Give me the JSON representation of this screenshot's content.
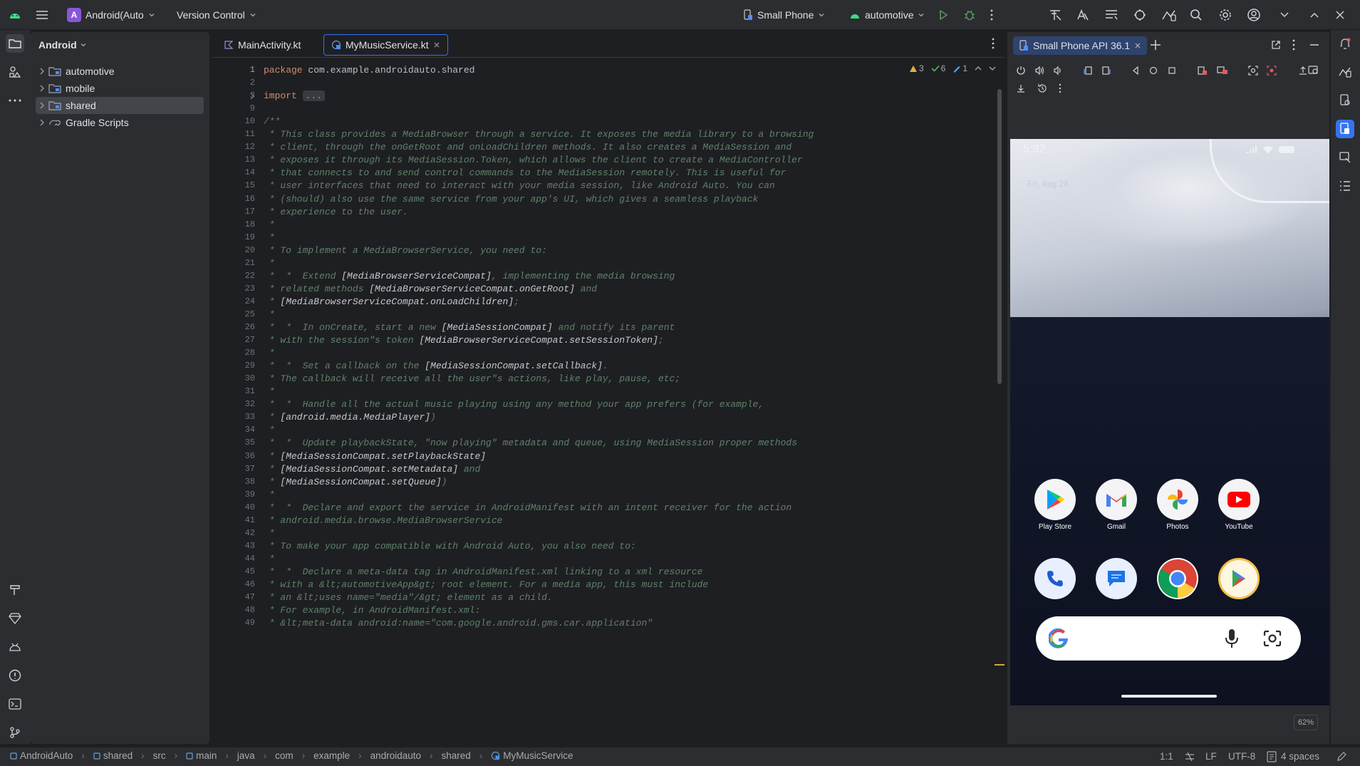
{
  "titlebar": {
    "project_badge": "A",
    "project_name": "Android(Auto",
    "vcs": "Version Control",
    "device": "Small Phone",
    "run_config": "automotive"
  },
  "project_panel": {
    "title": "Android",
    "items": [
      {
        "label": "automotive",
        "selected": false
      },
      {
        "label": "mobile",
        "selected": false
      },
      {
        "label": "shared",
        "selected": true
      },
      {
        "label": "Gradle Scripts",
        "selected": false
      }
    ]
  },
  "editor": {
    "tabs": [
      {
        "label": "MainActivity.kt",
        "active": false
      },
      {
        "label": "MyMusicService.kt",
        "active": true
      }
    ],
    "inspections": {
      "warnings": "3",
      "ok": "6",
      "typos": "1"
    },
    "line_numbers": [
      "1",
      "2",
      "3",
      "9",
      "10",
      "11",
      "12",
      "13",
      "14",
      "15",
      "16",
      "17",
      "18",
      "19",
      "20",
      "21",
      "22",
      "23",
      "24",
      "25",
      "26",
      "27",
      "28",
      "29",
      "30",
      "31",
      "32",
      "33",
      "34",
      "35",
      "36",
      "37",
      "38",
      "39",
      "40",
      "41",
      "42",
      "43",
      "44",
      "45",
      "46",
      "47",
      "48",
      "49"
    ],
    "lines": [
      {
        "a": "package",
        "b": " com.example.androidauto.shared"
      },
      {
        "a": "",
        "b": ""
      },
      {
        "a": "import",
        "b": "..."
      },
      {
        "t": ""
      },
      {
        "t": "/**"
      },
      {
        "t": " * This class provides a MediaBrowser through a service. It exposes the media library to a browsing"
      },
      {
        "t": " * client, through the onGetRoot and onLoadChildren methods. It also creates a MediaSession and"
      },
      {
        "t": " * exposes it through its MediaSession.Token, which allows the client to create a MediaController"
      },
      {
        "t": " * that connects to and send control commands to the MediaSession remotely. This is useful for"
      },
      {
        "t": " * user interfaces that need to interact with your media session, like Android Auto. You can"
      },
      {
        "t": " * (should) also use the same service from your app's UI, which gives a seamless playback"
      },
      {
        "t": " * experience to the user."
      },
      {
        "t": " *"
      },
      {
        "t": " *"
      },
      {
        "t": " * To implement a MediaBrowserService, you need to:"
      },
      {
        "t": " *"
      },
      {
        "p": " *  *  Extend ",
        "r": "[MediaBrowserServiceCompat]",
        "s": ", implementing the media browsing"
      },
      {
        "p": " * related methods ",
        "r": "[MediaBrowserServiceCompat.onGetRoot]",
        "s": " and"
      },
      {
        "p": " * ",
        "r": "[MediaBrowserServiceCompat.onLoadChildren]",
        "s": ";"
      },
      {
        "t": " *"
      },
      {
        "p": " *  *  In onCreate, start a new ",
        "r": "[MediaSessionCompat]",
        "s": " and notify its parent"
      },
      {
        "p": " * with the session\"s token ",
        "r": "[MediaBrowserServiceCompat.setSessionToken]",
        "s": ";"
      },
      {
        "t": " *"
      },
      {
        "p": " *  *  Set a callback on the ",
        "r": "[MediaSessionCompat.setCallback]",
        "s": "."
      },
      {
        "t": " * The callback will receive all the user\"s actions, like play, pause, etc;"
      },
      {
        "t": " *"
      },
      {
        "t": " *  *  Handle all the actual music playing using any method your app prefers (for example,"
      },
      {
        "p": " * ",
        "r": "[android.media.MediaPlayer]",
        "s": ")"
      },
      {
        "t": " *"
      },
      {
        "t": " *  *  Update playbackState, \"now playing\" metadata and queue, using MediaSession proper methods"
      },
      {
        "p": " * ",
        "r": "[MediaSessionCompat.setPlaybackState]",
        "s": ""
      },
      {
        "p": " * ",
        "r": "[MediaSessionCompat.setMetadata]",
        "s": " and"
      },
      {
        "p": " * ",
        "r": "[MediaSessionCompat.setQueue]",
        "s": ")"
      },
      {
        "t": " *"
      },
      {
        "t": " *  *  Declare and export the service in AndroidManifest with an intent receiver for the action"
      },
      {
        "t": " * android.media.browse.MediaBrowserService"
      },
      {
        "t": " *"
      },
      {
        "t": " * To make your app compatible with Android Auto, you also need to:"
      },
      {
        "t": " *"
      },
      {
        "t": " *  *  Declare a meta-data tag in AndroidManifest.xml linking to a xml resource"
      },
      {
        "t": " * with a &lt;automotiveApp&gt; root element. For a media app, this must include"
      },
      {
        "t": " * an &lt;uses name=\"media\"/&gt; element as a child."
      },
      {
        "t": " * For example, in AndroidManifest.xml:"
      },
      {
        "t": " * &lt;meta-data android:name=\"com.google.android.gms.car.application\""
      }
    ]
  },
  "device_panel": {
    "tab": "Small Phone API 36.1",
    "zoom": "62%",
    "phone": {
      "time": "5:32",
      "date": "Fri, Aug 28",
      "apps_row1": [
        "Play Store",
        "Gmail",
        "Photos",
        "YouTube"
      ]
    }
  },
  "statusbar": {
    "breadcrumbs": [
      "AndroidAuto",
      "shared",
      "src",
      "main",
      "java",
      "com",
      "example",
      "androidauto",
      "shared",
      "MyMusicService"
    ],
    "position": "1:1",
    "line_sep": "LF",
    "encoding": "UTF-8",
    "indent": "4 spaces"
  }
}
